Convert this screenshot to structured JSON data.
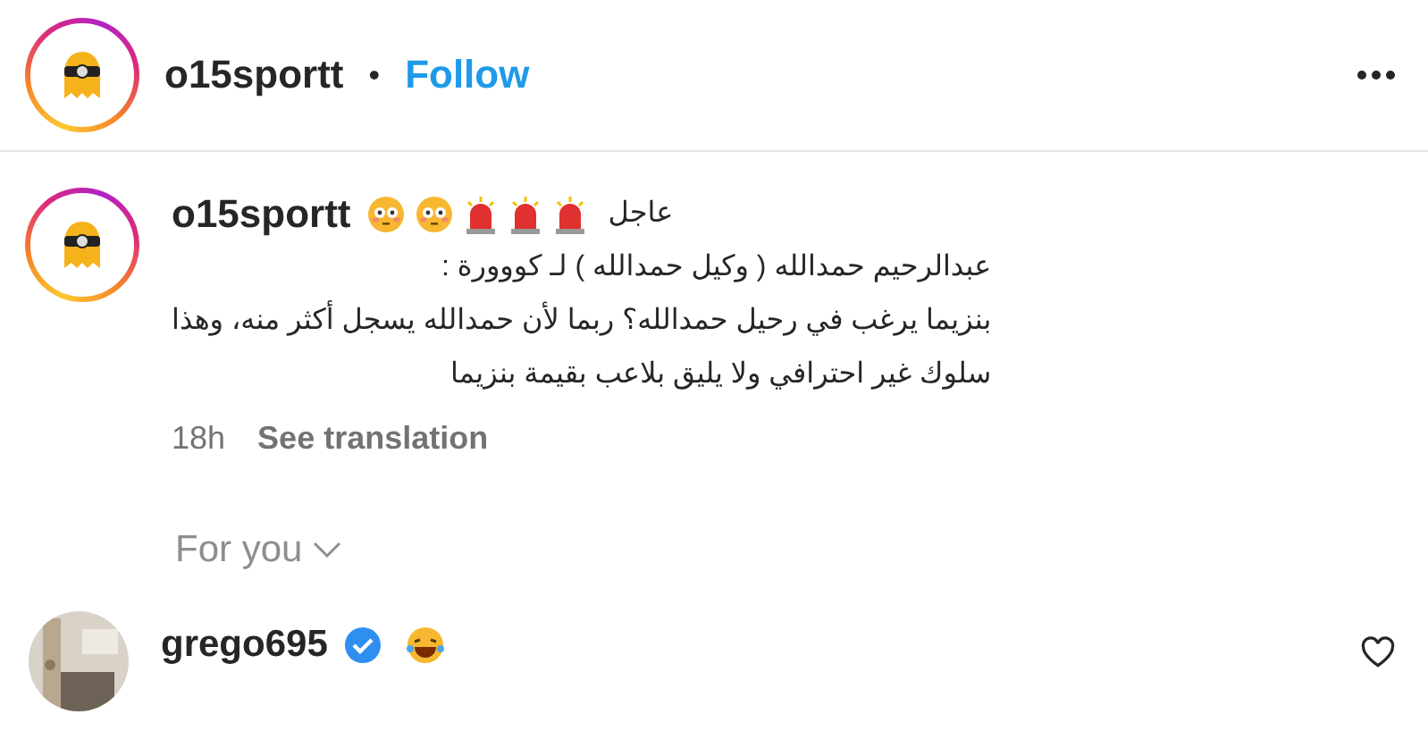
{
  "header": {
    "username": "o15sportt",
    "separator": "•",
    "follow": "Follow"
  },
  "caption": {
    "username": "o15sportt",
    "title": "عاجل",
    "lines": [
      "عبدالرحيم حمدالله ( وكيل حمدالله ) لـ كووورة :",
      "بنزيما يرغب في رحيل حمدالله؟ ربما لأن حمدالله يسجل أكثر منه، وهذا",
      "سلوك غير احترافي ولا يليق بلاعب بقيمة بنزيما"
    ],
    "time": "18h",
    "translate": "See translation"
  },
  "comments_filter": {
    "label": "For you"
  },
  "comments": [
    {
      "username": "grego695",
      "verified": true,
      "liked": false
    }
  ]
}
